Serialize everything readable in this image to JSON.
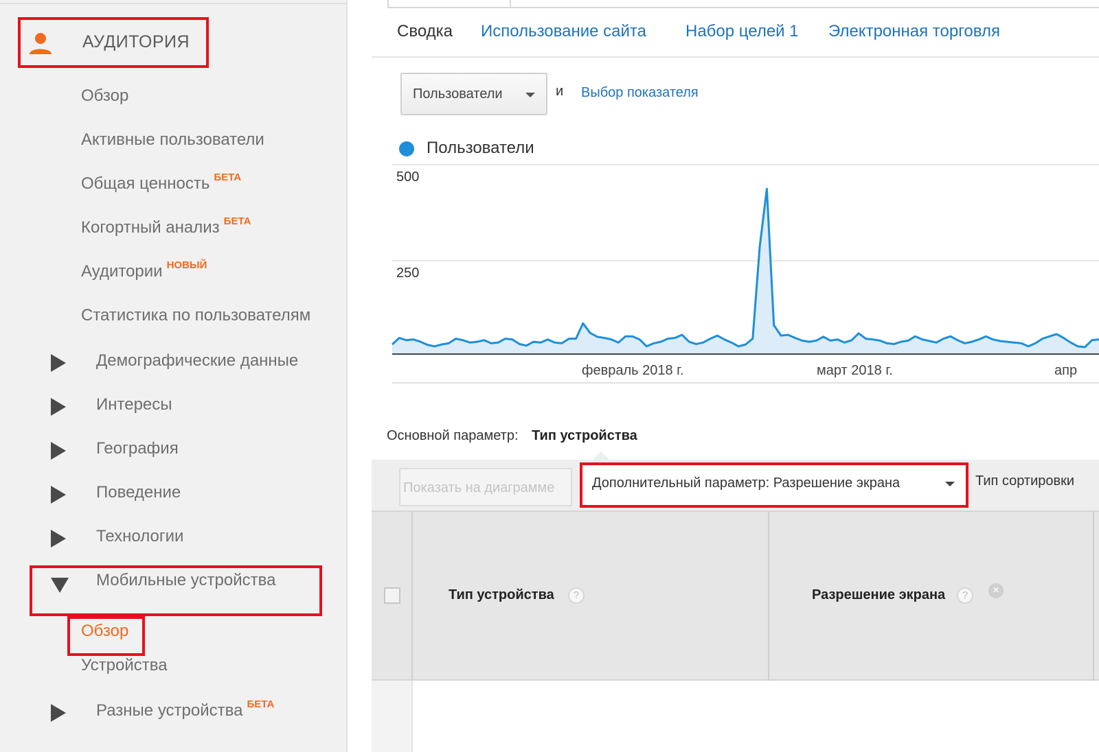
{
  "sidebar": {
    "header_label": "АУДИТОРИЯ",
    "items": [
      {
        "label": "Обзор",
        "badge": ""
      },
      {
        "label": "Активные пользователи",
        "badge": ""
      },
      {
        "label": "Общая ценность",
        "badge": "БЕТА"
      },
      {
        "label": "Когортный анализ",
        "badge": "БЕТА"
      },
      {
        "label": "Аудитории",
        "badge": "НОВЫЙ"
      },
      {
        "label": "Статистика по пользователям",
        "badge": ""
      }
    ],
    "groups": [
      {
        "label": "Демографические данные",
        "badge": ""
      },
      {
        "label": "Интересы",
        "badge": ""
      },
      {
        "label": "География",
        "badge": ""
      },
      {
        "label": "Поведение",
        "badge": ""
      },
      {
        "label": "Технологии",
        "badge": ""
      },
      {
        "label": "Мобильные устройства",
        "badge": ""
      }
    ],
    "mobile_children": [
      {
        "label": "Обзор"
      },
      {
        "label": "Устройства"
      }
    ],
    "last_group": {
      "label": "Разные устройства",
      "badge": "БЕТА"
    }
  },
  "tabs": [
    {
      "label": "Сводка"
    },
    {
      "label": "Использование сайта"
    },
    {
      "label": "Набор целей 1"
    },
    {
      "label": "Электронная торговля"
    }
  ],
  "metric_select": {
    "value": "Пользователи"
  },
  "and_label": "и",
  "choose_metric": "Выбор показателя",
  "chart_data": {
    "type": "area",
    "series": [
      {
        "name": "Пользователи",
        "color": "#1e8fd8",
        "values": [
          25,
          42,
          36,
          38,
          32,
          24,
          20,
          25,
          28,
          40,
          36,
          30,
          32,
          36,
          28,
          30,
          40,
          38,
          26,
          22,
          32,
          30,
          38,
          30,
          28,
          40,
          40,
          80,
          55,
          45,
          42,
          38,
          30,
          46,
          46,
          38,
          20,
          28,
          32,
          40,
          42,
          50,
          32,
          26,
          30,
          40,
          48,
          38,
          30,
          20,
          25,
          40,
          280,
          430,
          75,
          48,
          50,
          42,
          35,
          32,
          35,
          45,
          35,
          38,
          30,
          36,
          54,
          40,
          38,
          35,
          28,
          26,
          32,
          35,
          46,
          38,
          34,
          30,
          40,
          46,
          36,
          28,
          32,
          38,
          46,
          38,
          34,
          32,
          30,
          28,
          20,
          28,
          40,
          46,
          52,
          42,
          30,
          20,
          18,
          36,
          38
        ]
      }
    ],
    "x_tick_labels": [
      "февраль 2018 г.",
      "март 2018 г.",
      "апр"
    ],
    "y_tick_labels": [
      "500",
      "250"
    ],
    "ylim": [
      0,
      500
    ],
    "grid": true
  },
  "primary_dimension": {
    "label": "Основной параметр:",
    "value": "Тип устройства"
  },
  "toolbar": {
    "plot_button": "Показать на диаграмме",
    "secondary_dimension": "Дополнительный параметр: Разрешение экрана",
    "sort_type": "Тип сортировки"
  },
  "table": {
    "columns": [
      {
        "label": "Тип устройства"
      },
      {
        "label": "Разрешение экрана"
      }
    ],
    "help_glyph": "?",
    "remove_glyph": "×"
  },
  "colors": {
    "accent_orange": "#f26a1c",
    "link_blue": "#1e73be",
    "highlight_red": "#e8101d",
    "series_blue": "#1e8fd8"
  }
}
